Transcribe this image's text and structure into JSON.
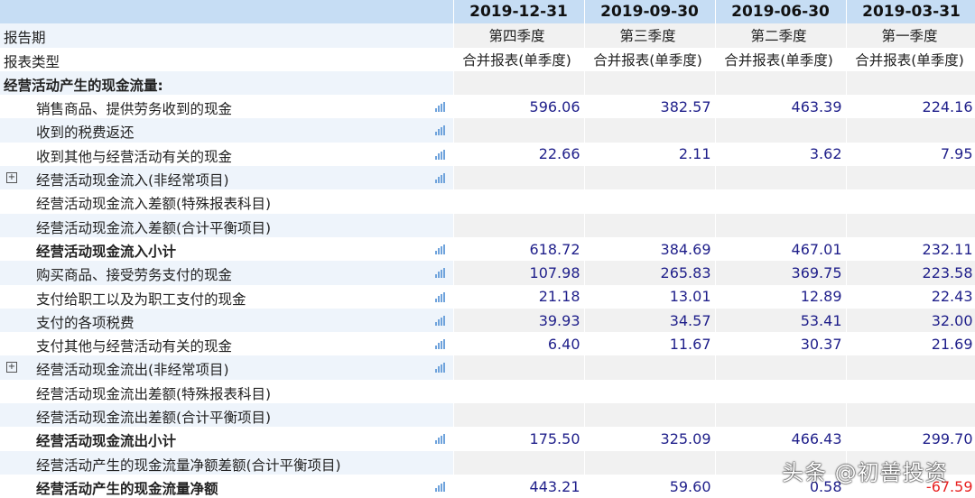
{
  "header": {
    "dates": [
      "2019-12-31",
      "2019-09-30",
      "2019-06-30",
      "2019-03-31"
    ]
  },
  "meta_rows": [
    {
      "label": "报告期",
      "values": [
        "第四季度",
        "第三季度",
        "第二季度",
        "第一季度"
      ]
    },
    {
      "label": "报表类型",
      "values": [
        "合并报表(单季度)",
        "合并报表(单季度)",
        "合并报表(单季度)",
        "合并报表(单季度)"
      ]
    }
  ],
  "rows": [
    {
      "label": "经营活动产生的现金流量:",
      "bold": true,
      "top": true,
      "chart": false,
      "expand": false,
      "values": [
        "",
        "",
        "",
        ""
      ]
    },
    {
      "label": "销售商品、提供劳务收到的现金",
      "chart": true,
      "values": [
        "596.06",
        "382.57",
        "463.39",
        "224.16"
      ]
    },
    {
      "label": "收到的税费返还",
      "chart": true,
      "values": [
        "",
        "",
        "",
        ""
      ]
    },
    {
      "label": "收到其他与经营活动有关的现金",
      "chart": true,
      "values": [
        "22.66",
        "2.11",
        "3.62",
        "7.95"
      ]
    },
    {
      "label": "经营活动现金流入(非经常项目)",
      "chart": true,
      "expand": true,
      "values": [
        "",
        "",
        "",
        ""
      ]
    },
    {
      "label": "经营活动现金流入差额(特殊报表科目)",
      "chart": false,
      "values": [
        "",
        "",
        "",
        ""
      ]
    },
    {
      "label": "经营活动现金流入差额(合计平衡项目)",
      "chart": false,
      "values": [
        "",
        "",
        "",
        ""
      ]
    },
    {
      "label": "经营活动现金流入小计",
      "bold": true,
      "chart": true,
      "values": [
        "618.72",
        "384.69",
        "467.01",
        "232.11"
      ]
    },
    {
      "label": "购买商品、接受劳务支付的现金",
      "chart": true,
      "values": [
        "107.98",
        "265.83",
        "369.75",
        "223.58"
      ]
    },
    {
      "label": "支付给职工以及为职工支付的现金",
      "chart": true,
      "values": [
        "21.18",
        "13.01",
        "12.89",
        "22.43"
      ]
    },
    {
      "label": "支付的各项税费",
      "chart": true,
      "values": [
        "39.93",
        "34.57",
        "53.41",
        "32.00"
      ]
    },
    {
      "label": "支付其他与经营活动有关的现金",
      "chart": true,
      "values": [
        "6.40",
        "11.67",
        "30.37",
        "21.69"
      ]
    },
    {
      "label": "经营活动现金流出(非经常项目)",
      "chart": true,
      "expand": true,
      "values": [
        "",
        "",
        "",
        ""
      ]
    },
    {
      "label": "经营活动现金流出差额(特殊报表科目)",
      "chart": false,
      "values": [
        "",
        "",
        "",
        ""
      ]
    },
    {
      "label": "经营活动现金流出差额(合计平衡项目)",
      "chart": false,
      "values": [
        "",
        "",
        "",
        ""
      ]
    },
    {
      "label": "经营活动现金流出小计",
      "bold": true,
      "chart": true,
      "values": [
        "175.50",
        "325.09",
        "466.43",
        "299.70"
      ]
    },
    {
      "label": "经营活动产生的现金流量净额差额(合计平衡项目)",
      "chart": false,
      "values": [
        "",
        "",
        "",
        ""
      ]
    },
    {
      "label": "经营活动产生的现金流量净额",
      "bold": true,
      "chart": true,
      "values": [
        "443.21",
        "59.60",
        "0.58",
        "-67.59"
      ]
    }
  ],
  "watermark": "头条 @初善投资",
  "colors": {
    "header": "#c6ddf4",
    "value": "#1f1f8a",
    "negative": "#e82020"
  }
}
